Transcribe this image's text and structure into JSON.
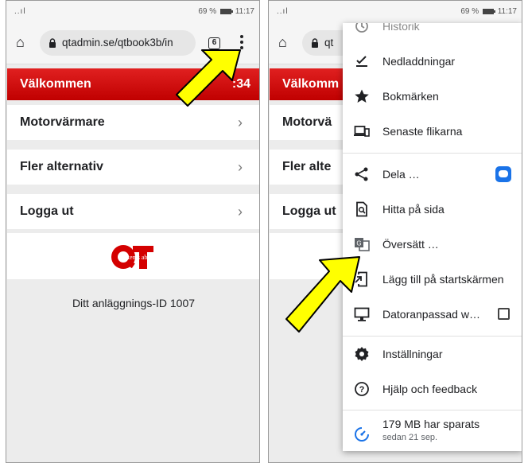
{
  "status": {
    "signal": "..ıl",
    "battery_percent": "69 %",
    "time": "11:17"
  },
  "browser": {
    "url": "qtadmin.se/qtbook3b/in",
    "tab_count": "6",
    "partial_url": "qt"
  },
  "app": {
    "welcome": "Välkommen",
    "welcome_time": ":34",
    "welcome_partial": "Välkomm",
    "items": [
      {
        "label": "Motorvärmare",
        "partial": "Motorvä"
      },
      {
        "label": "Fler alternativ",
        "partial": "Fler alte"
      },
      {
        "label": "Logga ut",
        "partial": "Logga ut"
      }
    ],
    "logo_text": "systems ab",
    "plant_id": "Ditt anläggnings-ID 1007",
    "chevron": "›"
  },
  "menu": {
    "items": [
      {
        "label": "Historik",
        "icon": "history-icon"
      },
      {
        "label": "Nedladdningar",
        "icon": "download-icon"
      },
      {
        "label": "Bokmärken",
        "icon": "star-icon"
      },
      {
        "label": "Senaste flikarna",
        "icon": "devices-icon"
      },
      {
        "label": "Dela …",
        "icon": "share-icon"
      },
      {
        "label": "Hitta på sida",
        "icon": "find-in-page-icon"
      },
      {
        "label": "Översätt …",
        "icon": "translate-icon"
      },
      {
        "label": "Lägg till på startskärmen",
        "icon": "add-to-home-screen-icon"
      },
      {
        "label": "Datoranpassad w…",
        "icon": "desktop-icon"
      },
      {
        "label": "Inställningar",
        "icon": "settings-icon"
      },
      {
        "label": "Hjälp och feedback",
        "icon": "help-icon"
      }
    ],
    "savings": {
      "title": "179 MB har sparats",
      "subtitle": "sedan 21 sep."
    }
  },
  "colors": {
    "header_red": "#d40000",
    "highlight_yellow": "#ffff00",
    "accent_blue": "#1a73e8"
  }
}
